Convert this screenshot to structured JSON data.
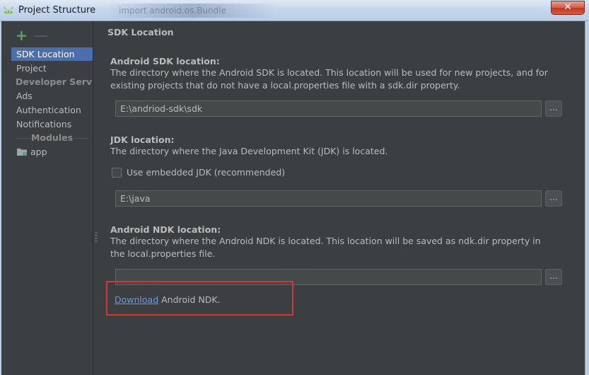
{
  "window": {
    "title": "Project Structure",
    "background_tab_text": "import android.os.Bundle",
    "close_glyph": "✕"
  },
  "sidebar": {
    "add_glyph": "+",
    "remove_glyph": "—",
    "items": [
      {
        "label": "SDK Location",
        "selected": true
      },
      {
        "label": "Project",
        "selected": false
      }
    ],
    "developer_services_header": "Developer Servi...",
    "developer_services": [
      {
        "label": "Ads"
      },
      {
        "label": "Authentication"
      },
      {
        "label": "Notifications"
      }
    ],
    "modules_header": "Modules",
    "modules": [
      {
        "label": "app",
        "icon": "module-folder-icon"
      }
    ]
  },
  "main": {
    "page_title": "SDK Location",
    "android_sdk": {
      "title": "Android SDK location:",
      "description": "The directory where the Android SDK is located. This location will be used for new projects, and for existing projects that do not have a local.properties file with a sdk.dir property.",
      "value": "E:\\andriod-sdk\\sdk",
      "browse_label": "..."
    },
    "jdk": {
      "title": "JDK location:",
      "description": "The directory where the Java Development Kit (JDK) is located.",
      "embedded_checkbox_label": "Use embedded JDK (recommended)",
      "embedded_checked": false,
      "value": "E:\\java",
      "browse_label": "..."
    },
    "ndk": {
      "title": "Android NDK location:",
      "description": "The directory where the Android NDK is located. This location will be saved as ndk.dir property in the local.properties file.",
      "value": "",
      "browse_label": "...",
      "download_link": "Download",
      "download_rest": " Android NDK."
    }
  },
  "colors": {
    "background": "#3c3f41",
    "selection": "#4b6eaf",
    "link": "#589df6",
    "highlight_annotation": "#e0322d"
  }
}
